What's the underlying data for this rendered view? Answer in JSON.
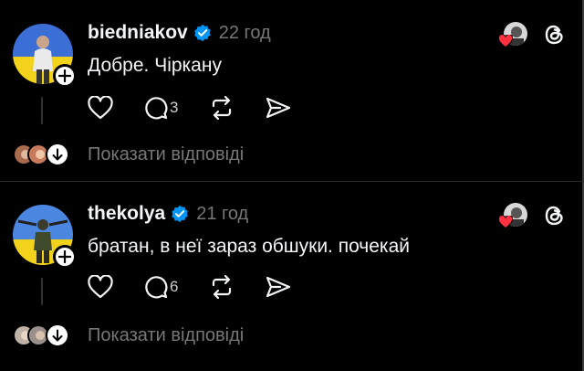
{
  "posts": [
    {
      "username": "biedniakov",
      "time": "22 год",
      "text": "Добре. Чіркану",
      "replies_count": "3",
      "show_replies": "Показати відповіді"
    },
    {
      "username": "thekolya",
      "time": "21 год",
      "text": "братан, в неї зараз обшуки. почекай",
      "replies_count": "6",
      "show_replies": "Показати відповіді"
    }
  ],
  "icons": {
    "verified": "verified-badge-icon",
    "like": "heart-outline-icon",
    "reply": "speech-bubble-icon",
    "repost": "repost-arrows-icon",
    "share": "send-icon",
    "threads": "threads-logo-icon",
    "follow": "plus-icon",
    "expand": "arrow-down-icon"
  },
  "colors": {
    "background": "#000000",
    "text": "#f3f5f7",
    "muted": "#777777",
    "verified": "#0095f6",
    "heart": "#ff3040"
  }
}
